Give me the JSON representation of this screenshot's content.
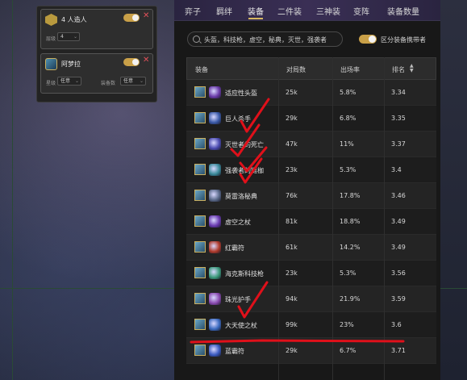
{
  "traits": [
    {
      "name": "4 人造人",
      "level_label": "层级",
      "level_value": "4"
    },
    {
      "name": "阿梦拉",
      "stars_label": "星级",
      "stars_value": "任意",
      "equip_label": "装备数",
      "equip_value": "任意"
    }
  ],
  "tabs": [
    "弈子",
    "羁绊",
    "装备",
    "二件装",
    "三神装",
    "变阵",
    "装备数量"
  ],
  "active_tab": "装备",
  "search": {
    "value": "头盔，科技枪，虚空，秘典，灭世，强袭者"
  },
  "carry_label": "区分装备携带者",
  "table": {
    "headers": [
      "装备",
      "对局数",
      "出场率",
      "排名"
    ],
    "rows": [
      {
        "item": "适应性头盔",
        "games": "25k",
        "rate": "5.8%",
        "rank": "3.34",
        "color": "#6a3aa8"
      },
      {
        "item": "巨人杀手",
        "games": "29k",
        "rate": "6.8%",
        "rank": "3.35",
        "color": "#3a5aa8"
      },
      {
        "item": "灭世者的死亡",
        "games": "47k",
        "rate": "11%",
        "rank": "3.37",
        "color": "#4a4ab0"
      },
      {
        "item": "强袭者的链枷",
        "games": "23k",
        "rate": "5.3%",
        "rank": "3.4",
        "color": "#3a8a9a"
      },
      {
        "item": "莫雷洛秘典",
        "games": "76k",
        "rate": "17.8%",
        "rank": "3.46",
        "color": "#5a6a8a"
      },
      {
        "item": "虚空之杖",
        "games": "81k",
        "rate": "18.8%",
        "rank": "3.49",
        "color": "#6a3ab0"
      },
      {
        "item": "红霸符",
        "games": "61k",
        "rate": "14.2%",
        "rank": "3.49",
        "color": "#b03a2a"
      },
      {
        "item": "海克斯科技枪",
        "games": "23k",
        "rate": "5.3%",
        "rank": "3.56",
        "color": "#3a9a7a"
      },
      {
        "item": "珠光护手",
        "games": "94k",
        "rate": "21.9%",
        "rank": "3.59",
        "color": "#8a4ab0"
      },
      {
        "item": "大天使之杖",
        "games": "99k",
        "rate": "23%",
        "rank": "3.6",
        "color": "#3a6ac0"
      },
      {
        "item": "蓝霸符",
        "games": "29k",
        "rate": "6.7%",
        "rank": "3.71",
        "color": "#3a5ac0"
      }
    ]
  },
  "colors": {
    "accent": "#d6b860",
    "annotation": "#e0101a",
    "close": "#e0505a"
  },
  "icons": [
    "search-icon",
    "sort-icon",
    "close-icon",
    "chevron-down-icon",
    "trait-icon",
    "champion-icon"
  ]
}
